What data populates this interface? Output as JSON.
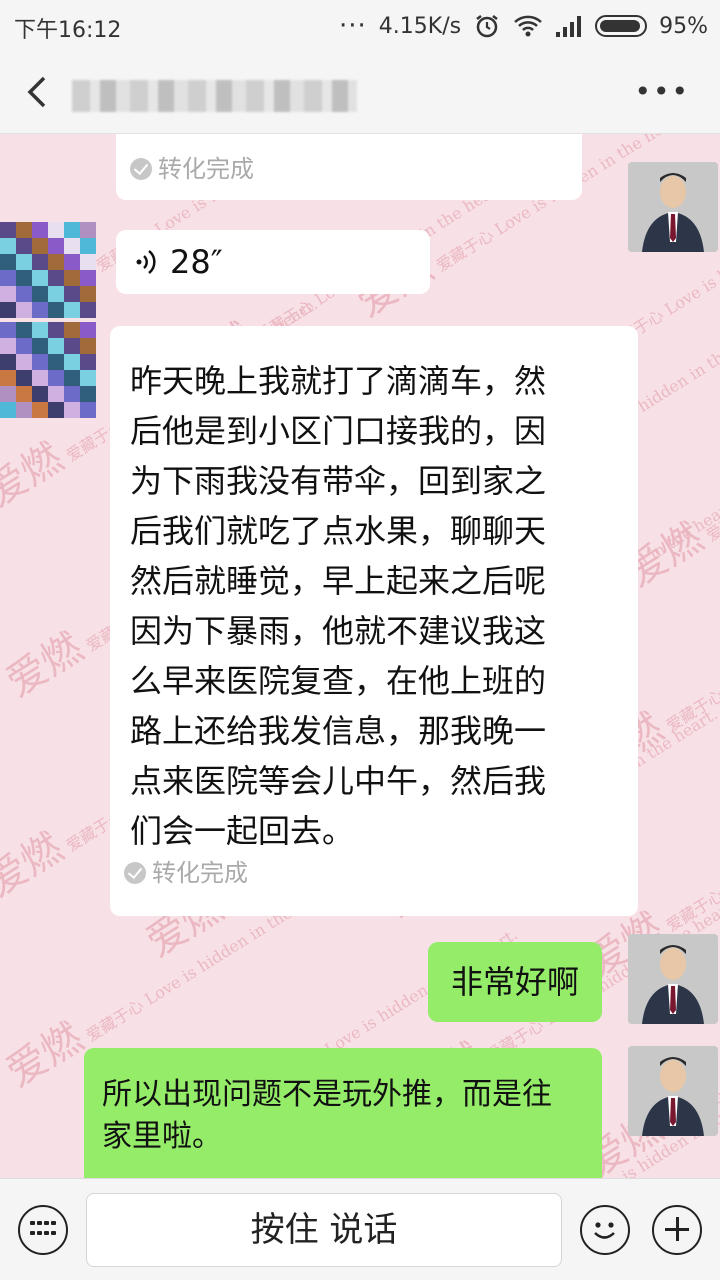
{
  "status_bar": {
    "time": "下午16:12",
    "net_speed": "4.15K/s",
    "battery": "95%"
  },
  "header": {
    "back_icon": "chevron-left-icon",
    "more_icon": "more-dots-icon"
  },
  "watermark": {
    "chars": "爱燃",
    "subtitle": "爱藏于心 Love is hidden in the heart."
  },
  "messages": [
    {
      "id": "m1",
      "side": "left",
      "kind": "status",
      "status": "转化完成"
    },
    {
      "id": "m2",
      "side": "left",
      "kind": "voice",
      "duration": "28″"
    },
    {
      "id": "m3",
      "side": "left",
      "kind": "text",
      "lines": [
        "昨天晚上我就打了滴滴车，然",
        "后他是到小区门口接我的，因",
        "为下雨我没有带伞，回到家之",
        "后我们就吃了点水果，聊聊天",
        "然后就睡觉，早上起来之后呢",
        "因为下暴雨，他就不建议我这",
        "么早来医院复查，在他上班的",
        "路上还给我发信息，那我晚一",
        "点来医院等会儿中午，然后我",
        "们会一起回去。"
      ],
      "status": "转化完成"
    },
    {
      "id": "m4",
      "side": "right",
      "kind": "text",
      "text": "非常好啊"
    },
    {
      "id": "m5",
      "side": "right",
      "kind": "text",
      "lines": [
        "所以出现问题不是玩外推，而是往",
        "家里啦。"
      ]
    }
  ],
  "input_bar": {
    "keyboard_icon": "keyboard-icon",
    "hold_to_talk": "按住 说话",
    "emoji_icon": "emoji-icon",
    "plus_icon": "plus-icon"
  },
  "colors": {
    "chat_bg": "#f7e1e6",
    "bubble_sent": "#95ec69",
    "bubble_received": "#ffffff",
    "watermark": "#eab4bf"
  }
}
